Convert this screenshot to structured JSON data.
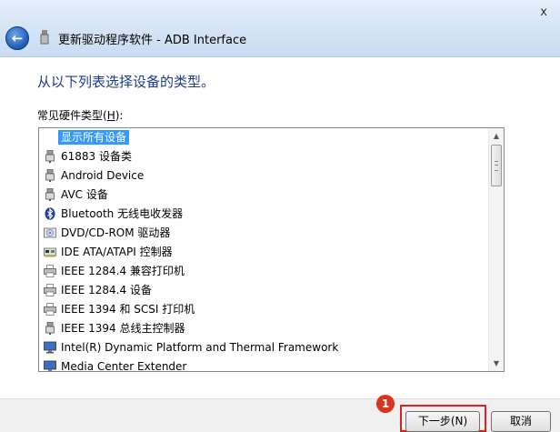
{
  "window": {
    "title": "更新驱动程序软件 - ADB Interface",
    "close_glyph": "x"
  },
  "main": {
    "heading": "从以下列表选择设备的类型。",
    "list_label_prefix": "常见硬件类型(",
    "list_label_key": "H",
    "list_label_suffix": "):"
  },
  "list": {
    "items": [
      {
        "label": "显示所有设备",
        "icon": "none",
        "selected": true
      },
      {
        "label": "61883 设备类",
        "icon": "usb-plug-icon"
      },
      {
        "label": "Android Device",
        "icon": "usb-plug-icon"
      },
      {
        "label": "AVC 设备",
        "icon": "usb-plug-icon"
      },
      {
        "label": "Bluetooth 无线电收发器",
        "icon": "bluetooth-icon"
      },
      {
        "label": "DVD/CD-ROM 驱动器",
        "icon": "disc-drive-icon"
      },
      {
        "label": "IDE ATA/ATAPI 控制器",
        "icon": "controller-card-icon"
      },
      {
        "label": "IEEE 1284.4 兼容打印机",
        "icon": "printer-icon"
      },
      {
        "label": "IEEE 1284.4 设备",
        "icon": "printer-icon"
      },
      {
        "label": "IEEE 1394 和 SCSI 打印机",
        "icon": "printer-icon"
      },
      {
        "label": "IEEE 1394 总线主控制器",
        "icon": "usb-plug-icon"
      },
      {
        "label": "Intel(R) Dynamic Platform and Thermal Framework",
        "icon": "monitor-icon"
      },
      {
        "label": "Media Center Extender",
        "icon": "monitor-icon"
      }
    ]
  },
  "buttons": {
    "next": "下一步(N)",
    "cancel": "取消"
  },
  "annotation": {
    "step_number": "1"
  },
  "colors": {
    "heading": "#1e3b8a",
    "selection": "#3399ff",
    "highlight_border": "#e02020"
  }
}
